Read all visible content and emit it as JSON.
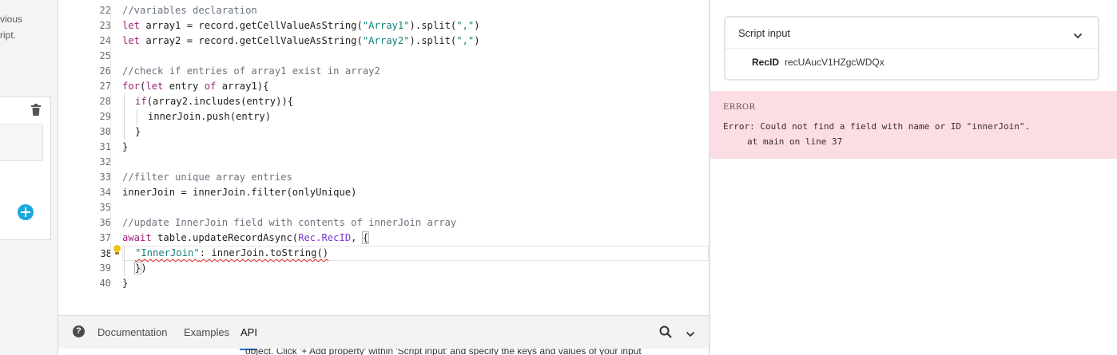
{
  "left_panel": {
    "description_lines": [
      "vious",
      "ript."
    ]
  },
  "editor": {
    "lines": [
      {
        "num": "22",
        "tokens": [
          [
            "cmt",
            "//variables declaration"
          ]
        ]
      },
      {
        "num": "23",
        "tokens": [
          [
            "kw",
            "let"
          ],
          [
            "p",
            " array1 = record.getCellValueAsString("
          ],
          [
            "str",
            "\"Array1\""
          ],
          [
            "p",
            ").split("
          ],
          [
            "str",
            "\",\""
          ],
          [
            "p",
            ")"
          ]
        ]
      },
      {
        "num": "24",
        "tokens": [
          [
            "kw",
            "let"
          ],
          [
            "p",
            " array2 = record.getCellValueAsString("
          ],
          [
            "str",
            "\"Array2\""
          ],
          [
            "p",
            ").split("
          ],
          [
            "str",
            "\",\""
          ],
          [
            "p",
            ")"
          ]
        ]
      },
      {
        "num": "25",
        "tokens": []
      },
      {
        "num": "26",
        "tokens": [
          [
            "cmt",
            "//check if entries of array1 exist in array2"
          ]
        ]
      },
      {
        "num": "27",
        "tokens": [
          [
            "kw",
            "for"
          ],
          [
            "p",
            "("
          ],
          [
            "kw",
            "let"
          ],
          [
            "p",
            " entry "
          ],
          [
            "kw",
            "of"
          ],
          [
            "p",
            " array1){"
          ]
        ]
      },
      {
        "num": "28",
        "indent": 1,
        "tokens": [
          [
            "kw",
            "if"
          ],
          [
            "p",
            "(array2.includes(entry)){"
          ]
        ]
      },
      {
        "num": "29",
        "indent": 2,
        "tokens": [
          [
            "p",
            "innerJoin.push(entry)"
          ]
        ]
      },
      {
        "num": "30",
        "indent": 1,
        "tokens": [
          [
            "p",
            "}"
          ]
        ]
      },
      {
        "num": "31",
        "tokens": [
          [
            "p",
            "}"
          ]
        ]
      },
      {
        "num": "32",
        "tokens": []
      },
      {
        "num": "33",
        "tokens": [
          [
            "cmt",
            "//filter unique array entries"
          ]
        ]
      },
      {
        "num": "34",
        "tokens": [
          [
            "p",
            "innerJoin = innerJoin.filter(onlyUnique)"
          ]
        ]
      },
      {
        "num": "35",
        "tokens": []
      },
      {
        "num": "36",
        "tokens": [
          [
            "cmt",
            "//update InnerJoin field with contents of innerJoin array"
          ]
        ]
      },
      {
        "num": "37",
        "tokens": [
          [
            "kw",
            "await"
          ],
          [
            "p",
            " table.updateRecordAsync("
          ],
          [
            "ref",
            "Rec.RecID"
          ],
          [
            "p",
            ", "
          ],
          [
            "box",
            "{"
          ]
        ]
      },
      {
        "num": "38",
        "indent": 1,
        "current": true,
        "tokens": [
          [
            "str",
            "\"InnerJoin\""
          ],
          [
            "p",
            ": innerJoin.toString()"
          ]
        ]
      },
      {
        "num": "39",
        "indent": 1,
        "tokens": [
          [
            "box",
            "}"
          ],
          [
            "p",
            ")"
          ]
        ]
      },
      {
        "num": "40",
        "tokens": [
          [
            "p",
            "}"
          ]
        ]
      }
    ]
  },
  "docs": {
    "help_glyph": "?",
    "tabs": [
      "Documentation",
      "Examples",
      "API"
    ],
    "active_tab": "API",
    "footer_text": "object. Click '+ Add property' within 'Script input' and specify the keys and values of your input"
  },
  "script_input": {
    "title": "Script input",
    "key": "RecID",
    "value": "recUAucV1HZgcWDQx"
  },
  "error": {
    "label": "ERROR",
    "message": "Error: Could not find a field with name or ID \"innerJoin\".",
    "trace": "at main on line 37"
  },
  "colors": {
    "error_bg": "#fcdde4",
    "keyword": "#a0247b",
    "string": "#16807c",
    "comment": "#6a737d",
    "accent": "#1776c9"
  },
  "icons": [
    "trash-icon",
    "add-circle-icon",
    "lightbulb-icon",
    "help-icon",
    "search-icon",
    "chevron-down-icon"
  ]
}
